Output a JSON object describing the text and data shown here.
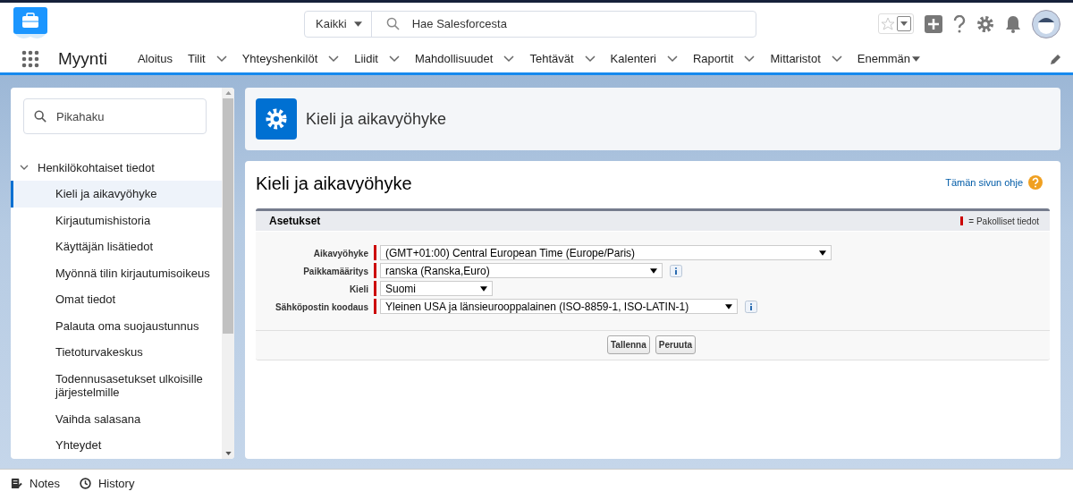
{
  "app": {
    "name": "Myynti"
  },
  "search": {
    "scope": "Kaikki",
    "placeholder": "Hae Salesforcesta"
  },
  "nav": [
    {
      "label": "Aloitus",
      "kind": "plain"
    },
    {
      "label": "Tilit",
      "kind": "dropdown"
    },
    {
      "label": "Yhteyshenkilöt",
      "kind": "dropdown"
    },
    {
      "label": "Liidit",
      "kind": "dropdown"
    },
    {
      "label": "Mahdollisuudet",
      "kind": "dropdown"
    },
    {
      "label": "Tehtävät",
      "kind": "dropdown"
    },
    {
      "label": "Kalenteri",
      "kind": "dropdown"
    },
    {
      "label": "Raportit",
      "kind": "dropdown"
    },
    {
      "label": "Mittaristot",
      "kind": "dropdown"
    },
    {
      "label": "Enemmän",
      "kind": "more"
    }
  ],
  "sidebar": {
    "search_placeholder": "Pikahaku",
    "section": {
      "label": "Henkilökohtaiset tiedot",
      "expanded": true,
      "children": [
        {
          "label": "Kieli ja aikavyöhyke",
          "selected": true
        },
        {
          "label": "Kirjautumishistoria",
          "selected": false
        },
        {
          "label": "Käyttäjän lisätiedot",
          "selected": false
        },
        {
          "label": "Myönnä tilin kirjautumisoikeus",
          "selected": false
        },
        {
          "label": "Omat tiedot",
          "selected": false
        },
        {
          "label": "Palauta oma suojaustunnus",
          "selected": false
        },
        {
          "label": "Tietoturvakeskus",
          "selected": false
        },
        {
          "label": "Todennusasetukset ulkoisille järjestelmille",
          "selected": false
        },
        {
          "label": "Vaihda salasana",
          "selected": false
        },
        {
          "label": "Yhteydet",
          "selected": false
        }
      ]
    }
  },
  "page_header": {
    "title": "Kieli ja aikavyöhyke"
  },
  "content": {
    "title": "Kieli ja aikavyöhyke",
    "help_link": "Tämän sivun ohje",
    "section": {
      "title": "Asetukset",
      "legend": "= Pakolliset tiedot",
      "fields": [
        {
          "label": "Aikavyöhyke",
          "value": "(GMT+01:00) Central European Time (Europe/Paris)",
          "required": true,
          "info": false
        },
        {
          "label": "Paikkamääritys",
          "value": "ranska (Ranska,Euro)",
          "required": true,
          "info": true
        },
        {
          "label": "Kieli",
          "value": "Suomi",
          "required": true,
          "info": false
        },
        {
          "label": "Sähköpostin koodaus",
          "value": "Yleinen USA ja länsieurooppalainen (ISO-8859-1, ISO-LATIN-1)",
          "required": true,
          "info": true
        }
      ]
    },
    "buttons": [
      "Tallenna",
      "Peruuta"
    ]
  },
  "footer": [
    {
      "label": "Notes",
      "kind": "notes"
    },
    {
      "label": "History",
      "kind": "history"
    }
  ]
}
